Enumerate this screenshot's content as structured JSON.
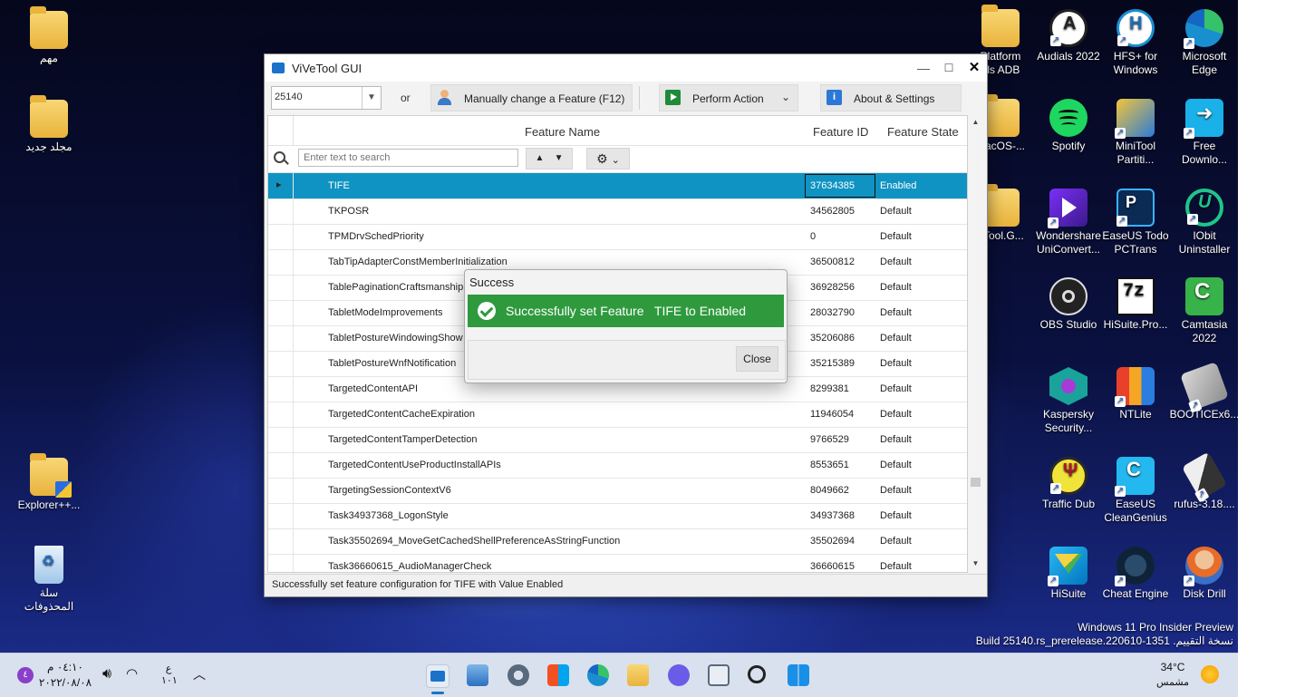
{
  "desktop": {
    "left_icons": [
      {
        "label": "مهم",
        "icon": "folder-icon"
      },
      {
        "label": "مجلد جديد",
        "icon": "folder-icon"
      },
      {
        "label": "Explorer++...",
        "icon": "explorer-folder-icon"
      },
      {
        "label": "سلة",
        "label2": "المحذوفات",
        "icon": "recycle-bin-icon"
      }
    ],
    "right_icons": [
      {
        "label": "Platform",
        "label2": "ols ADB",
        "icon": "folder-icon"
      },
      {
        "label": "Audials 2022",
        "label2": "",
        "icon": "audials-icon"
      },
      {
        "label": "HFS+ for",
        "label2": "Windows",
        "icon": "hfs-icon"
      },
      {
        "label": "Microsoft",
        "label2": "Edge",
        "icon": "edge-icon"
      },
      {
        "label": "MacOS-...",
        "label2": "",
        "icon": "folder-icon"
      },
      {
        "label": "Spotify",
        "label2": "",
        "icon": "spotify-icon"
      },
      {
        "label": "MiniTool",
        "label2": "Partiti...",
        "icon": "minitool-icon"
      },
      {
        "label": "Free",
        "label2": "Downlo...",
        "icon": "free-download-icon"
      },
      {
        "label": "eTool.G...",
        "label2": "",
        "icon": "folder-icon"
      },
      {
        "label": "Wondershare",
        "label2": "UniConvert...",
        "icon": "uniconverter-icon"
      },
      {
        "label": "EaseUS Todo",
        "label2": "PCTrans",
        "icon": "pctrans-icon"
      },
      {
        "label": "IObit",
        "label2": "Uninstaller",
        "icon": "iobit-icon"
      },
      {
        "label": "OBS Studio",
        "label2": "",
        "icon": "obs-icon"
      },
      {
        "label": "HiSuite.Pro...",
        "label2": "",
        "icon": "7z-icon"
      },
      {
        "label": "Camtasia",
        "label2": "2022",
        "icon": "camtasia-icon"
      },
      {
        "label": "Kaspersky",
        "label2": "Security...",
        "icon": "kaspersky-icon"
      },
      {
        "label": "NTLite",
        "label2": "",
        "icon": "ntlite-icon"
      },
      {
        "label": "BOOTICEx6...",
        "label2": "",
        "icon": "bootice-icon"
      },
      {
        "label": "Traffic Dub",
        "label2": "",
        "icon": "traffic-dub-icon"
      },
      {
        "label": "EaseUS",
        "label2": "CleanGenius",
        "icon": "cleangenius-icon"
      },
      {
        "label": "rufus-3.18....",
        "label2": "",
        "icon": "rufus-icon"
      },
      {
        "label": "HiSuite",
        "label2": "",
        "icon": "hisuite-icon"
      },
      {
        "label": "Cheat Engine",
        "label2": "",
        "icon": "cheat-engine-icon"
      },
      {
        "label": "Disk Drill",
        "label2": "",
        "icon": "disk-drill-icon"
      }
    ],
    "watermark": {
      "line1": "Windows 11 Pro Insider Preview",
      "line2": "Build 25140.rs_prerelease.220610-1351 .نسخة التقييم"
    }
  },
  "window": {
    "title": "ViVeTool GUI",
    "controls": {
      "minimize": "—",
      "maximize": "☐",
      "close": "✕"
    },
    "toolbar": {
      "build_value": "25140",
      "or_label": "or",
      "manual_label": "Manually change a Feature (F12)",
      "perform_label": "Perform Action",
      "about_label": "About & Settings"
    },
    "grid": {
      "columns": {
        "name": "Feature Name",
        "id": "Feature ID",
        "state": "Feature State"
      },
      "search_placeholder": "Enter text to search",
      "rows": [
        {
          "name": "TIFE",
          "id": "37634385",
          "state": "Enabled"
        },
        {
          "name": "TKPOSR",
          "id": "34562805",
          "state": "Default"
        },
        {
          "name": "TPMDrvSchedPriority",
          "id": "0",
          "state": "Default"
        },
        {
          "name": "TabTipAdapterConstMemberInitialization",
          "id": "36500812",
          "state": "Default"
        },
        {
          "name": "TablePaginationCraftsmanship",
          "id": "36928256",
          "state": "Default"
        },
        {
          "name": "TabletModeImprovements",
          "id": "28032790",
          "state": "Default"
        },
        {
          "name": "TabletPostureWindowingShow",
          "id": "35206086",
          "state": "Default"
        },
        {
          "name": "TabletPostureWnfNotification",
          "id": "35215389",
          "state": "Default"
        },
        {
          "name": "TargetedContentAPI",
          "id": "8299381",
          "state": "Default"
        },
        {
          "name": "TargetedContentCacheExpiration",
          "id": "11946054",
          "state": "Default"
        },
        {
          "name": "TargetedContentTamperDetection",
          "id": "9766529",
          "state": "Default"
        },
        {
          "name": "TargetedContentUseProductInstallAPIs",
          "id": "8553651",
          "state": "Default"
        },
        {
          "name": "TargetingSessionContextV6",
          "id": "8049662",
          "state": "Default"
        },
        {
          "name": "Task34937368_LogonStyle",
          "id": "34937368",
          "state": "Default"
        },
        {
          "name": "Task35502694_MoveGetCachedShellPreferenceAsStringFunction",
          "id": "35502694",
          "state": "Default"
        },
        {
          "name": "Task36660615_AudioManagerCheck",
          "id": "36660615",
          "state": "Default"
        }
      ]
    },
    "status": "Successfully set feature configuration for  TIFE with Value Enabled"
  },
  "dialog": {
    "title": "Success",
    "message": "Successfully set Feature   TIFE to Enabled",
    "close_label": "Close"
  },
  "taskbar": {
    "weather_temp": "34°C",
    "weather_desc": "مشمس",
    "lang_top": "ع",
    "lang_bottom": "١٠١",
    "time": "٠٤:١٠ م",
    "date": "٢٠٢٢/٠٨/٠٨",
    "notification_count": "٤"
  },
  "colors": {
    "selection": "#0f93c2",
    "success_banner": "#2e9a3d",
    "taskbar": "#d9e1ee"
  }
}
